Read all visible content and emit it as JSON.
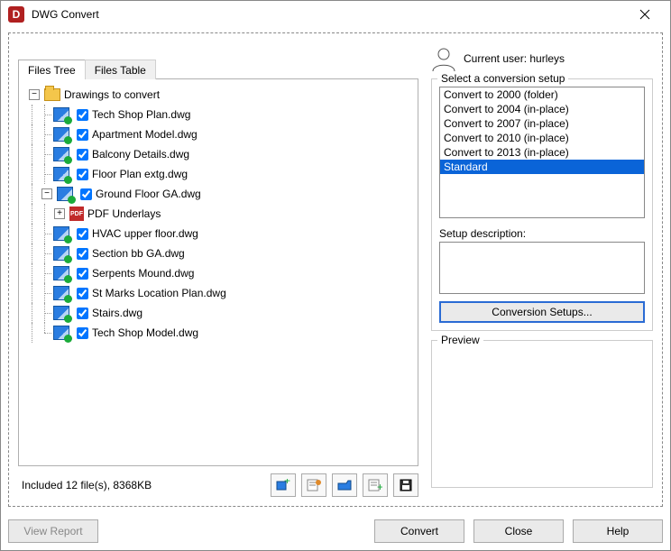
{
  "window": {
    "title": "DWG Convert"
  },
  "user": {
    "label": "Current user: hurleys"
  },
  "tabs": {
    "tree": "Files Tree",
    "table": "Files Table"
  },
  "tree": {
    "root": "Drawings to convert",
    "items": [
      "Tech Shop Plan.dwg",
      "Apartment Model.dwg",
      "Balcony Details.dwg",
      "Floor Plan extg.dwg",
      "Ground Floor GA.dwg",
      "PDF Underlays",
      "HVAC upper floor.dwg",
      "Section bb GA.dwg",
      "Serpents Mound.dwg",
      "St Marks Location Plan.dwg",
      "Stairs.dwg",
      "Tech Shop Model.dwg"
    ]
  },
  "status": {
    "text": "Included 12 file(s), 8368KB"
  },
  "setups": {
    "legend": "Select a conversion setup",
    "items": [
      "Convert to 2000 (folder)",
      "Convert to 2004 (in-place)",
      "Convert to 2007 (in-place)",
      "Convert to 2010 (in-place)",
      "Convert to 2013 (in-place)",
      "Standard"
    ],
    "desc_label": "Setup description:",
    "button": "Conversion Setups..."
  },
  "preview": {
    "legend": "Preview"
  },
  "footer": {
    "view_report": "View Report",
    "convert": "Convert",
    "close": "Close",
    "help": "Help"
  }
}
